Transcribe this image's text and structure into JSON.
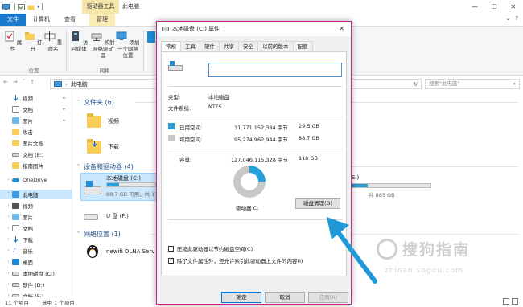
{
  "titlebar": {
    "drive_tools_tab": "驱动器工具",
    "title": "此电脑",
    "min": "—",
    "max": "☐",
    "close": "✕"
  },
  "tabs": {
    "file": "文件",
    "computer": "计算机",
    "view": "查看",
    "manage": "管理"
  },
  "ribbon": {
    "buttons": {
      "properties": "属性",
      "open": "打开",
      "rename": "重命名",
      "access_media": "访问媒体",
      "map_drive": "映射网络驱动器",
      "add_location": "添加一个网络位置"
    },
    "groups": {
      "location": "位置",
      "network": "网络"
    }
  },
  "address": {
    "path": "此电脑",
    "search_placeholder": "搜索\"此电脑\""
  },
  "sidebar": {
    "items": [
      "视频",
      "文档",
      "图片",
      "攻击",
      "图片文档",
      "文档 (E:)",
      "指南图片",
      "OneDrive",
      "此电脑",
      "视频",
      "图片",
      "文档",
      "下载",
      "音乐",
      "桌面",
      "本地磁盘 (C:)",
      "软件 (D:)",
      "文档 (E:)"
    ]
  },
  "content": {
    "folders_header": "文件夹 (6)",
    "folder_video": "视频",
    "folder_download": "下载",
    "devices_header": "设备和驱动器 (4)",
    "drive_c": "本地磁盘 (C:)",
    "drive_c_cap": "88.7 GB 可用，共 118 GB",
    "drive_e": "(E:)",
    "drive_e_cap": "共 885 GB",
    "usb": "U 盘 (F:)",
    "net_header": "网络位置 (1)",
    "net_item": "newifi DLNA Server"
  },
  "status": {
    "count": "11 个项目",
    "selected": "选中 1 个项目"
  },
  "dialog": {
    "title": "本地磁盘 (C:) 属性",
    "tabs": [
      "常规",
      "工具",
      "硬件",
      "共享",
      "安全",
      "以前的版本",
      "配额"
    ],
    "type_label": "类型:",
    "type_value": "本地磁盘",
    "fs_label": "文件系统:",
    "fs_value": "NTFS",
    "used_label": "已用空间:",
    "used_bytes": "31,771,152,384 字节",
    "used_gb": "29.5 GB",
    "free_label": "可用空间:",
    "free_bytes": "95,274,962,944 字节",
    "free_gb": "88.7 GB",
    "capacity_label": "容量:",
    "capacity_bytes": "127,046,115,328 字节",
    "capacity_gb": "118 GB",
    "drive_label": "驱动器 C:",
    "cleanup": "磁盘清理(D)",
    "compress": "压缩此驱动器以节约磁盘空间(C)",
    "index": "除了文件属性外，还允许索引此驱动器上文件的内容(I)",
    "ok": "确定",
    "cancel": "取消",
    "apply": "应用(A)",
    "used_fraction": 0.249,
    "colors": {
      "used": "#26a0da",
      "free": "#c8c8c8"
    }
  },
  "watermark": {
    "logo_text": "搜狗指南",
    "sub": "zhinan.sogou.com"
  }
}
